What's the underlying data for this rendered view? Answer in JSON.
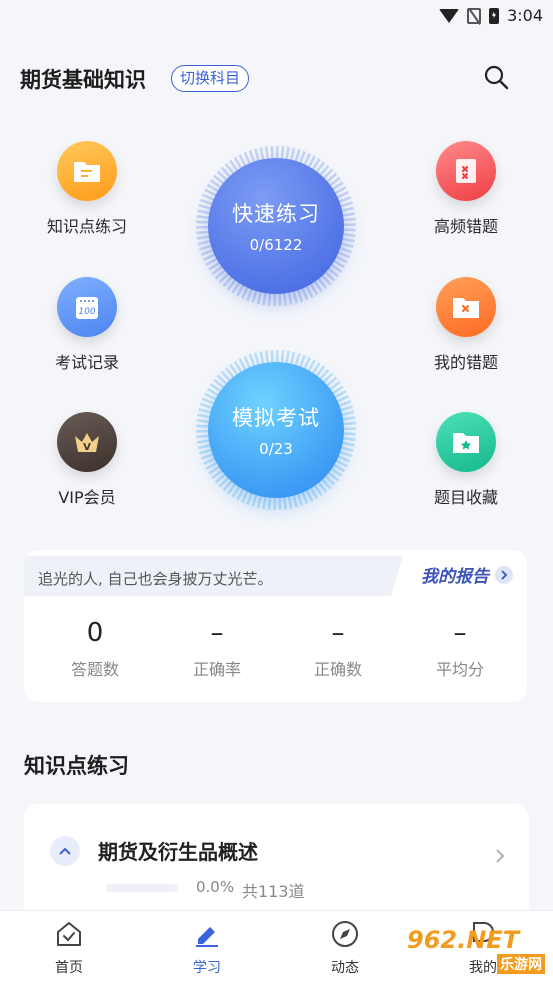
{
  "status_bar": {
    "time": "3:04"
  },
  "header": {
    "title": "期货基础知识",
    "switch_label": "切换科目"
  },
  "left_items": [
    {
      "label": "知识点练习",
      "icon": "folder-doc-icon",
      "color": "#ffae2a"
    },
    {
      "label": "考试记录",
      "icon": "calendar-100-icon",
      "color": "#5a8df5"
    },
    {
      "label": "VIP会员",
      "icon": "crown-icon",
      "color": "#4b3f3a"
    }
  ],
  "right_items": [
    {
      "label": "高频错题",
      "icon": "error-doc-icon",
      "color": "#f4575a"
    },
    {
      "label": "我的错题",
      "icon": "error-folder-icon",
      "color": "#ff7a33"
    },
    {
      "label": "题目收藏",
      "icon": "star-folder-icon",
      "color": "#1fc79b"
    }
  ],
  "quick_practice": {
    "title": "快速练习",
    "progress": "0/6122"
  },
  "mock_exam": {
    "title": "模拟考试",
    "progress": "0/23"
  },
  "report": {
    "quote": "追光的人, 自己也会身披万丈光芒。",
    "link_label": "我的报告",
    "stats": [
      {
        "value": "0",
        "label": "答题数"
      },
      {
        "value": "–",
        "label": "正确率"
      },
      {
        "value": "–",
        "label": "正确数"
      },
      {
        "value": "–",
        "label": "平均分"
      }
    ]
  },
  "section": {
    "title": "知识点练习"
  },
  "chapter": {
    "title": "期货及衍生品概述",
    "percent": "0.0%",
    "count": "共113道",
    "progress": 0
  },
  "nav": [
    {
      "label": "首页",
      "icon": "home-icon",
      "active": false
    },
    {
      "label": "学习",
      "icon": "pen-icon",
      "active": true
    },
    {
      "label": "动态",
      "icon": "compass-icon",
      "active": false
    },
    {
      "label": "我的",
      "icon": "profile-icon",
      "active": false
    }
  ],
  "watermark": {
    "text": "962.NET",
    "sub": "乐游网"
  },
  "colors": {
    "accent": "#3b63d9",
    "quick_start": "#6f90f2",
    "quick_end": "#3f63df",
    "mock_start": "#5cc4fb",
    "mock_end": "#2b86f0"
  }
}
